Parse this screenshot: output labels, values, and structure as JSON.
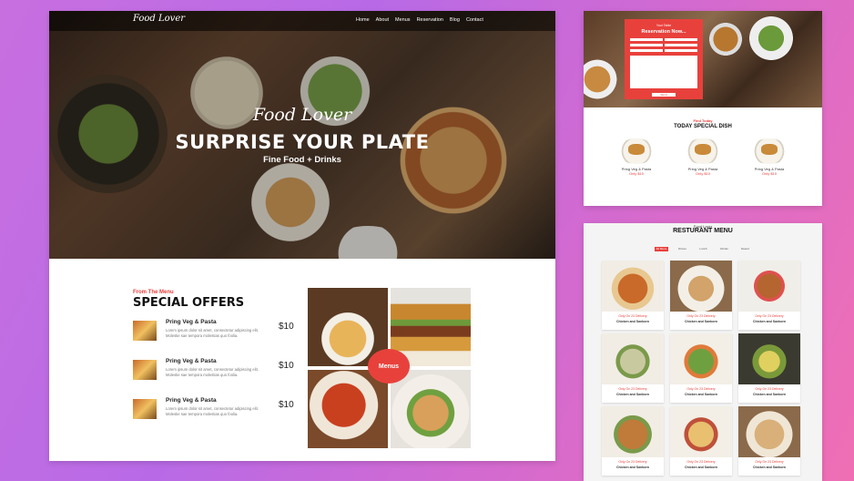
{
  "main": {
    "logo": "Food Lover",
    "nav": [
      "Home",
      "About",
      "Menus",
      "Reservation",
      "Blog",
      "Contact"
    ],
    "hero_script": "Food Lover",
    "hero_title": "SURPRISE YOUR PLATE",
    "hero_subtitle": "Fine Food + Drinks",
    "offers_kicker": "From The Menu",
    "offers_title": "SPECIAL OFFERS",
    "offers": [
      {
        "name": "Pring Veg & Pasta",
        "desc": "Lorem ipsum dolor sit amet, consectetur adipiscing elit. Molestie sae tempora molestias quo foolia.",
        "price": "$10"
      },
      {
        "name": "Pring Veg & Pasta",
        "desc": "Lorem ipsum dolor sit amet, consectetur adipiscing elit. Molestie sae tempora molestias quo foolia.",
        "price": "$10"
      },
      {
        "name": "Pring Veg & Pasta",
        "desc": "Lorem ipsum dolor sit amet, consectetur adipiscing elit. Molestie sae tempora molestias quo foolia.",
        "price": "$10"
      }
    ],
    "menus_button": "Menus"
  },
  "reservation": {
    "form_kicker": "Your Table",
    "form_title": "Reservation Now...",
    "send_label": "Send",
    "special_kicker": "Find Today",
    "special_title": "TODAY SPECIAL DISH",
    "dishes": [
      {
        "name": "Pring Veg & Pasta",
        "price": "Only $10"
      },
      {
        "name": "Pring Veg & Pasta",
        "price": "Only $10"
      },
      {
        "name": "Pring Veg & Pasta",
        "price": "Only $10"
      }
    ]
  },
  "menu_panel": {
    "kicker": "Food Lover",
    "title": "RESTURANT MENU",
    "tabs": [
      "All Menu",
      "Dinner",
      "Lunch",
      "Drinks",
      "Desert"
    ],
    "card_price": "Only On 23 Delivery",
    "card_name": "Chicken and Sanborn"
  },
  "colors": {
    "accent": "#e8413c",
    "background_left": "#c86fe0",
    "background_right": "#f06fb4"
  }
}
